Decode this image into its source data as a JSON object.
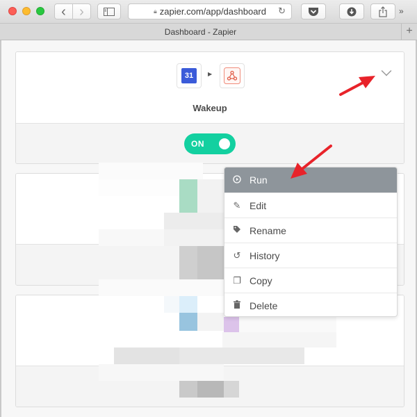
{
  "browser": {
    "url": "zapier.com/app/dashboard",
    "tab_title": "Dashboard - Zapier",
    "back_icon": "‹",
    "forward_icon": "›",
    "reload_icon": "↻",
    "more_icon": "»",
    "new_tab_icon": "+"
  },
  "zap": {
    "title": "Wakeup",
    "trigger_app_badge": "31",
    "toggle_label": "ON",
    "toggle_color": "#13d0a0"
  },
  "menu": {
    "items": [
      {
        "label": "Run",
        "icon": "play-icon",
        "glyph": "▶"
      },
      {
        "label": "Edit",
        "icon": "pencil-icon",
        "glyph": "✎"
      },
      {
        "label": "Rename",
        "icon": "tag-icon",
        "glyph": "◆"
      },
      {
        "label": "History",
        "icon": "history-icon",
        "glyph": "↺"
      },
      {
        "label": "Copy",
        "icon": "copy-icon",
        "glyph": "❐"
      },
      {
        "label": "Delete",
        "icon": "trash-icon",
        "glyph": "■"
      }
    ],
    "active_color": "#8e959b"
  },
  "annotation_color": "#e8232a"
}
